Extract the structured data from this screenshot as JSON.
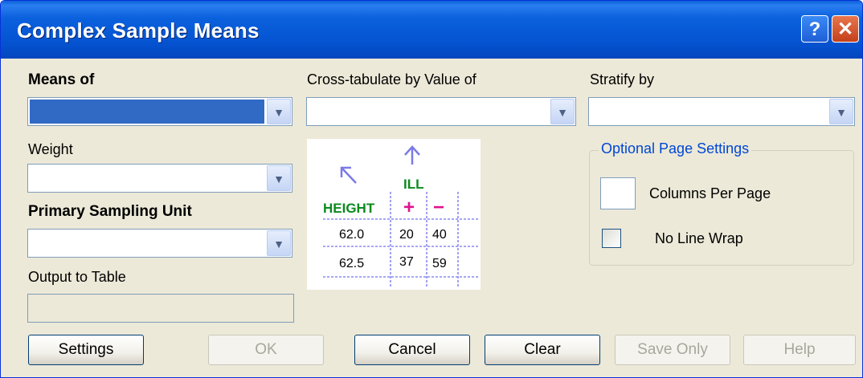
{
  "window": {
    "title": "Complex Sample Means",
    "help_glyph": "?",
    "close_glyph": "✕"
  },
  "labels": {
    "means_of": "Means of",
    "cross_tab": "Cross-tabulate by Value of",
    "stratify": "Stratify by",
    "weight": "Weight",
    "psu": "Primary Sampling Unit",
    "output": "Output to Table"
  },
  "fields": {
    "means_of_value": "",
    "cross_tab_value": "",
    "stratify_value": "",
    "weight_value": "",
    "psu_value": "",
    "output_value": ""
  },
  "optional": {
    "group_title": "Optional Page Settings",
    "columns_label": "Columns Per Page",
    "columns_value": "",
    "no_wrap_label": "No Line Wrap",
    "no_wrap_checked": false
  },
  "illustration": {
    "col_var": "ILL",
    "row_var": "HEIGHT",
    "plus": "+",
    "minus": "−",
    "rows": [
      {
        "label": "62.0",
        "plus": "20",
        "minus": "40"
      },
      {
        "label": "62.5",
        "plus": "37",
        "minus": "59"
      }
    ]
  },
  "buttons": {
    "settings": "Settings",
    "ok": "OK",
    "cancel": "Cancel",
    "clear": "Clear",
    "save_only": "Save Only",
    "help": "Help"
  },
  "colors": {
    "title_bar": "#0554d2",
    "selection": "#316ac5",
    "group_title": "#0046d5",
    "dialog_bg": "#ece9d8"
  }
}
